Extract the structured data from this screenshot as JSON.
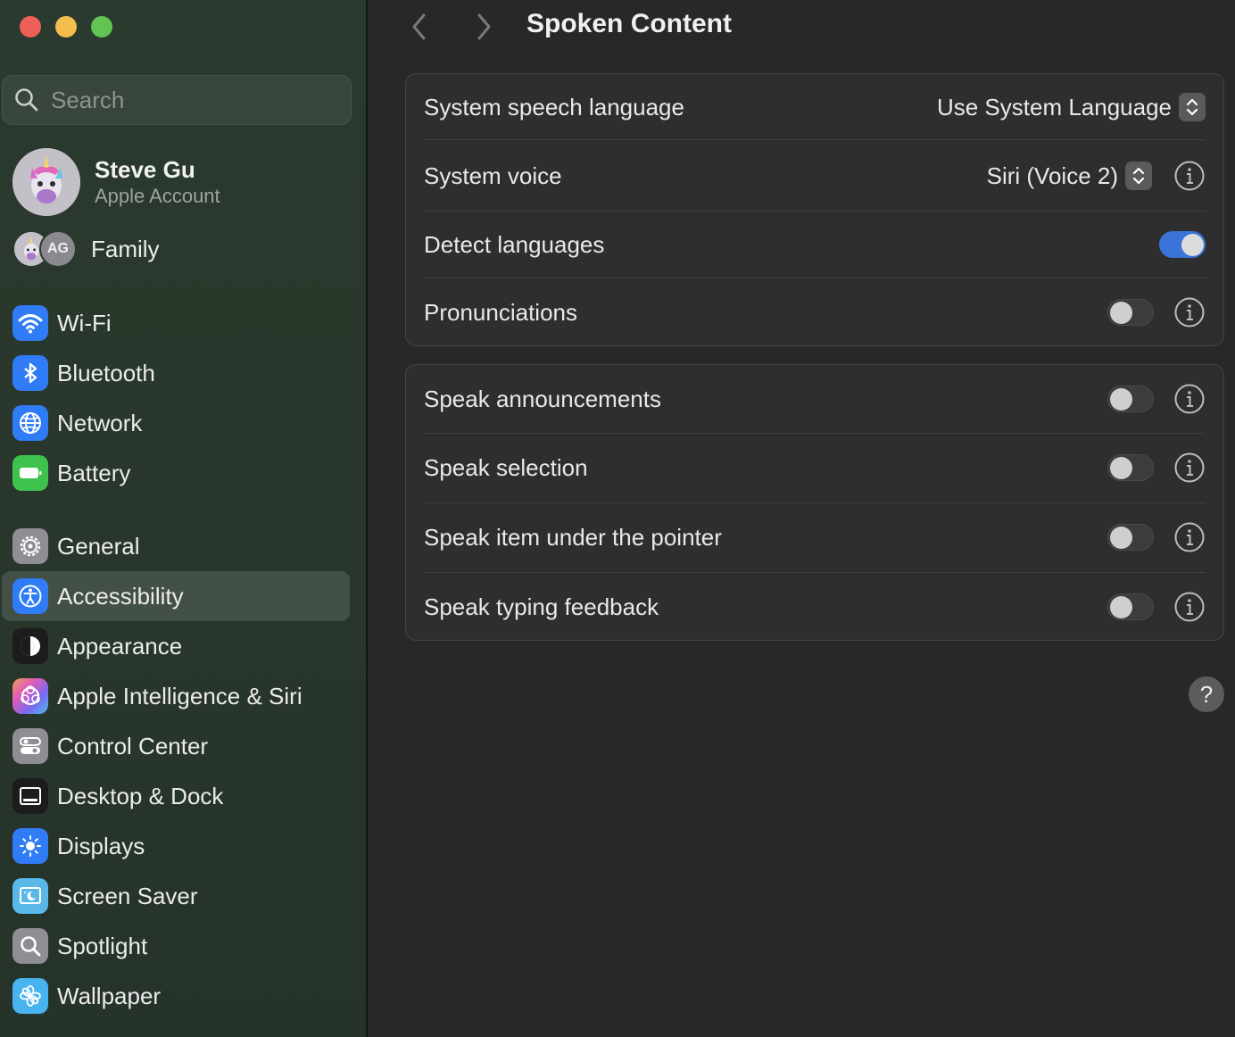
{
  "window": {
    "title": "Spoken Content"
  },
  "search": {
    "placeholder": "Search"
  },
  "account": {
    "name": "Steve Gu",
    "subtitle": "Apple Account"
  },
  "family": {
    "label": "Family",
    "initials": "AG"
  },
  "sidebar": {
    "items": [
      {
        "label": "Wi-Fi",
        "icon": "wifi-icon",
        "color": "#2f7cf6"
      },
      {
        "label": "Bluetooth",
        "icon": "bluetooth-icon",
        "color": "#2f7cf6"
      },
      {
        "label": "Network",
        "icon": "globe-icon",
        "color": "#2f7cf6"
      },
      {
        "label": "Battery",
        "icon": "battery-icon",
        "color": "#3fc24d"
      },
      {
        "label": "General",
        "icon": "gear-icon",
        "color": "#8e8e93"
      },
      {
        "label": "Accessibility",
        "icon": "accessibility-icon",
        "color": "#2f7cf6",
        "selected": true
      },
      {
        "label": "Appearance",
        "icon": "appearance-icon",
        "color": "#1c1c1c"
      },
      {
        "label": "Apple Intelligence & Siri",
        "icon": "siri-icon",
        "color": "#d070c8"
      },
      {
        "label": "Control Center",
        "icon": "control-center-icon",
        "color": "#8e8e93"
      },
      {
        "label": "Desktop & Dock",
        "icon": "dock-icon",
        "color": "#1c1c1c"
      },
      {
        "label": "Displays",
        "icon": "sun-icon",
        "color": "#2f7cf6"
      },
      {
        "label": "Screen Saver",
        "icon": "screen-saver-icon",
        "color": "#5ab8e8"
      },
      {
        "label": "Spotlight",
        "icon": "magnifier-icon",
        "color": "#8e8e93"
      },
      {
        "label": "Wallpaper",
        "icon": "flower-icon",
        "color": "#47b4f0"
      }
    ]
  },
  "settings": {
    "group1": {
      "speech_language": {
        "label": "System speech language",
        "value": "Use System Language"
      },
      "system_voice": {
        "label": "System voice",
        "value": "Siri (Voice 2)"
      },
      "detect_languages": {
        "label": "Detect languages",
        "on": true
      },
      "pronunciations": {
        "label": "Pronunciations",
        "on": false
      }
    },
    "group2": {
      "speak_announcements": {
        "label": "Speak announcements",
        "on": false
      },
      "speak_selection": {
        "label": "Speak selection",
        "on": false
      },
      "speak_pointer": {
        "label": "Speak item under the pointer",
        "on": false
      },
      "speak_typing": {
        "label": "Speak typing feedback",
        "on": false
      }
    }
  },
  "help": {
    "label": "?"
  },
  "colors": {
    "accent": "#3a74d8",
    "sidebar_bg": "#2a382d",
    "main_bg": "#282828"
  }
}
